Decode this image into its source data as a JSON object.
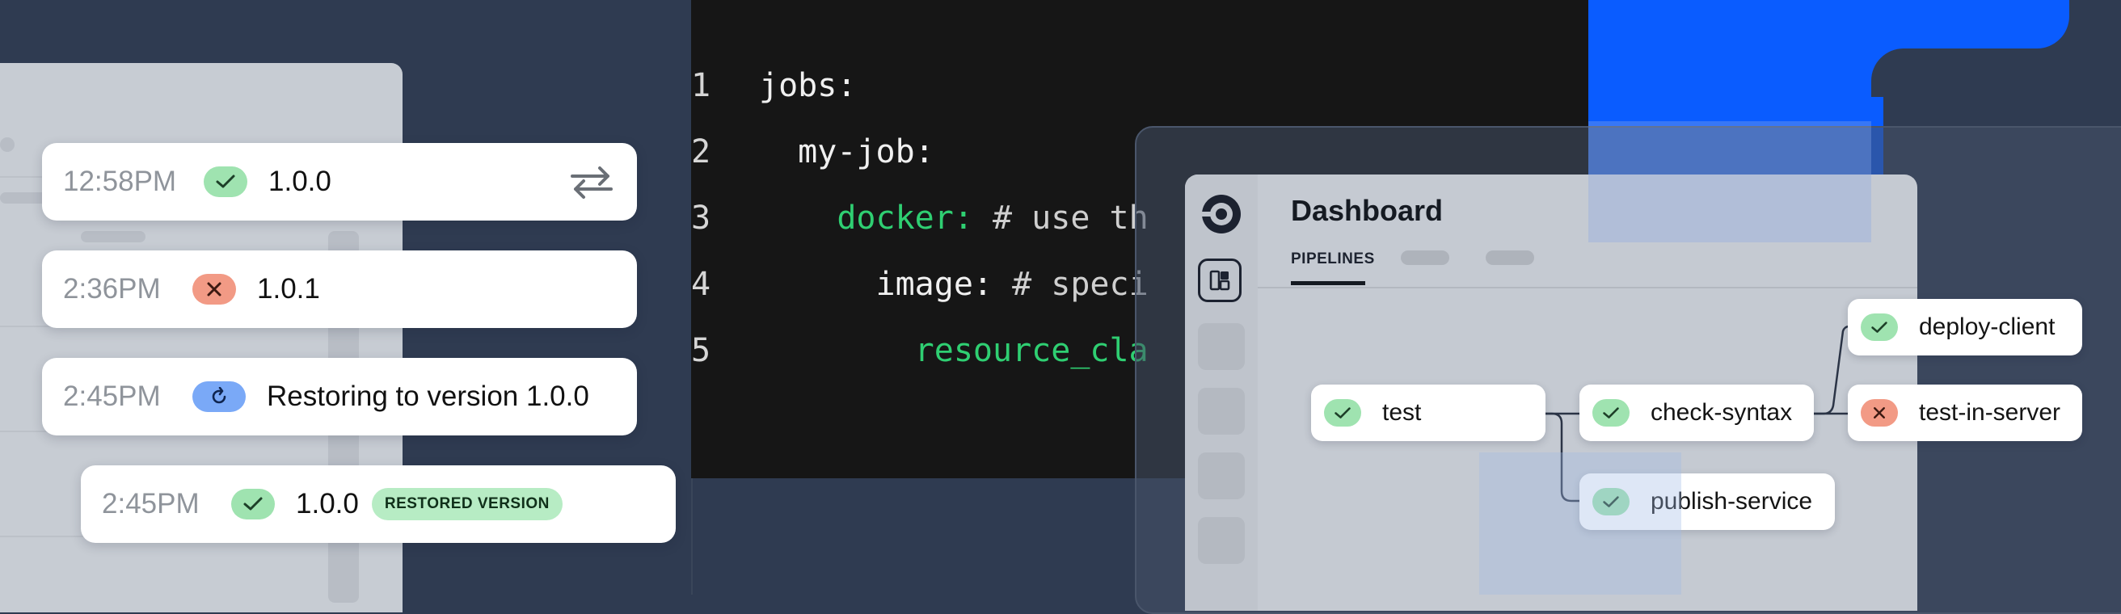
{
  "history": {
    "entries": [
      {
        "time": "12:58PM",
        "status": "success",
        "version": "1.0.0"
      },
      {
        "time": "2:36PM",
        "status": "failed",
        "version": "1.0.1"
      },
      {
        "time": "2:45PM",
        "status": "restoring",
        "version": "Restoring to version 1.0.0"
      },
      {
        "time": "2:45PM",
        "status": "success",
        "version": "1.0.0",
        "tag": "RESTORED VERSION"
      }
    ]
  },
  "code": {
    "lines": [
      {
        "num": "1",
        "indent": "",
        "key": "jobs:",
        "comment": ""
      },
      {
        "num": "2",
        "indent": "  ",
        "key": "my-job:",
        "comment": ""
      },
      {
        "num": "3",
        "indent": "    ",
        "key": "docker:",
        "comment": " # use th"
      },
      {
        "num": "4",
        "indent": "      ",
        "key": "image:",
        "comment": " # speci"
      },
      {
        "num": "5",
        "indent": "        ",
        "key": "resource_cla",
        "comment": ""
      }
    ]
  },
  "dashboard": {
    "title": "Dashboard",
    "tab": "PIPELINES",
    "nodes": [
      {
        "label": "test",
        "status": "success"
      },
      {
        "label": "check-syntax",
        "status": "success"
      },
      {
        "label": "publish-service",
        "status": "success"
      },
      {
        "label": "deploy-client",
        "status": "success"
      },
      {
        "label": "test-in-server",
        "status": "failed"
      }
    ]
  },
  "icons": {
    "success": "check-icon",
    "failed": "x-icon",
    "restoring": "refresh-icon",
    "swap": "swap-arrows-icon",
    "logo": "circleci-logo-icon",
    "dashboard": "dashboard-grid-icon"
  },
  "colors": {
    "success_bg": "#9fe3b0",
    "failed_bg": "#f29a85",
    "restoring_bg": "#7aa9f7",
    "brand_blue": "#0a5cff",
    "code_green": "#2fcf72"
  }
}
